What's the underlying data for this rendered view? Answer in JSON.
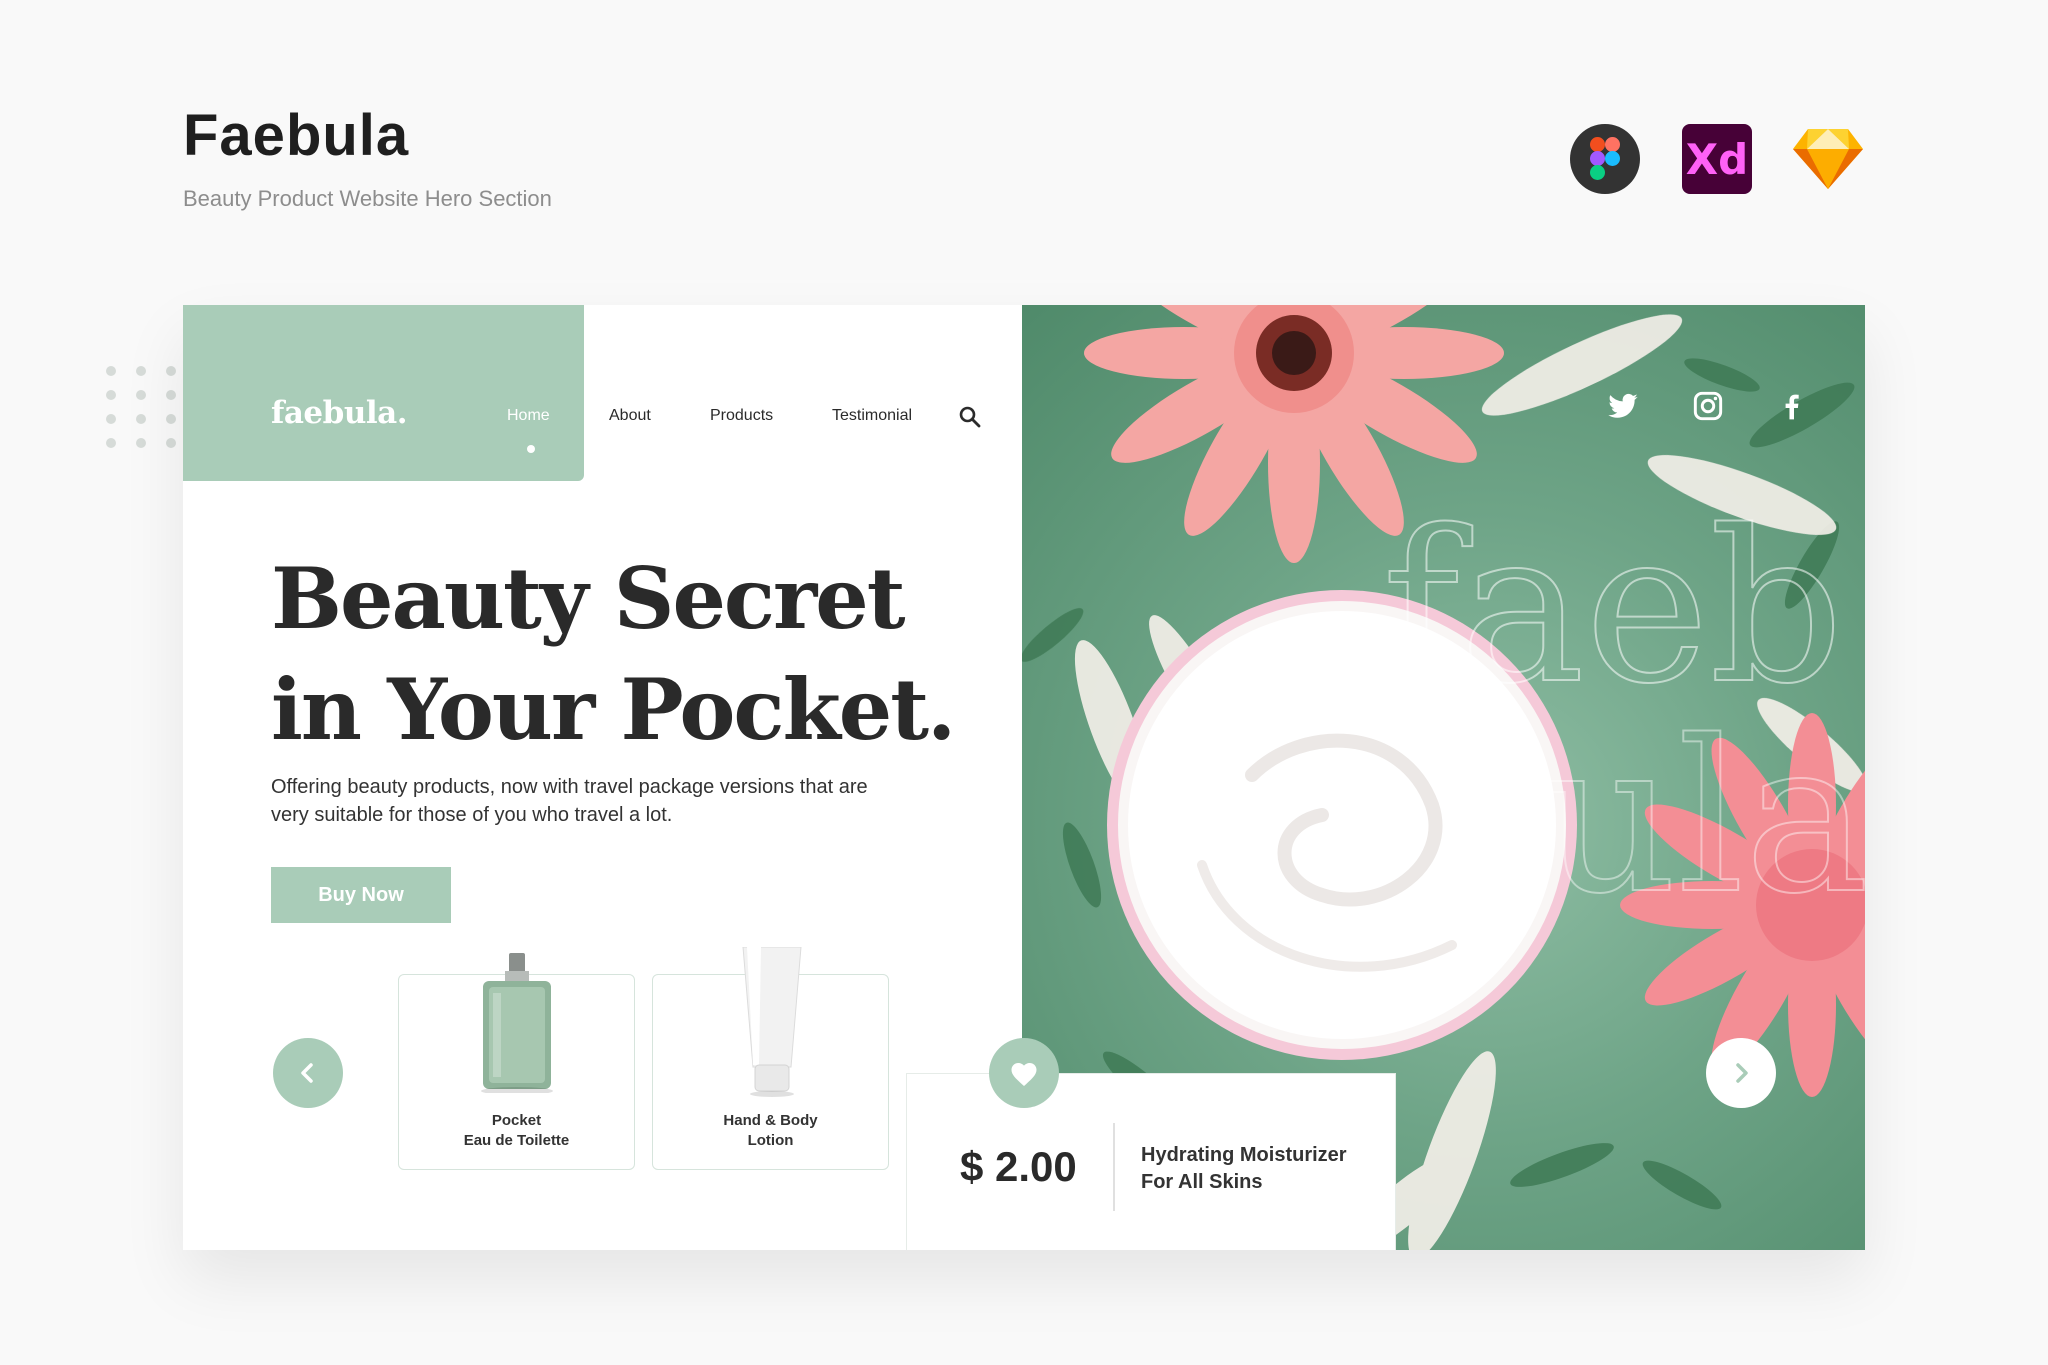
{
  "presentation": {
    "title": "Faebula",
    "subtitle": "Beauty Product Website Hero Section",
    "tools": [
      {
        "name": "figma-icon"
      },
      {
        "name": "xd-icon",
        "text": "Xd"
      },
      {
        "name": "sketch-icon"
      }
    ]
  },
  "site": {
    "logo": "faebula.",
    "nav": {
      "home": "Home",
      "about": "About",
      "products": "Products",
      "testimonial": "Testimonial"
    },
    "hero": {
      "headline_line1": "Beauty Secret",
      "headline_line2": "in Your Pocket.",
      "description": "Offering beauty products, now with travel package versions that are very suitable for those of you who travel a lot.",
      "cta": "Buy Now"
    },
    "products": [
      {
        "label": "Pocket\nEau de Toilette"
      },
      {
        "label": "Hand & Body\nLotion"
      }
    ],
    "featured": {
      "price": "$ 2.00",
      "name": "Hydrating Moisturizer For All Skins"
    },
    "watermark": {
      "line1": "faeb",
      "line2": "ula"
    }
  },
  "colors": {
    "accent": "#a9ccb8",
    "text_dark": "#2a2a2a",
    "background": "#f9f9f9"
  }
}
